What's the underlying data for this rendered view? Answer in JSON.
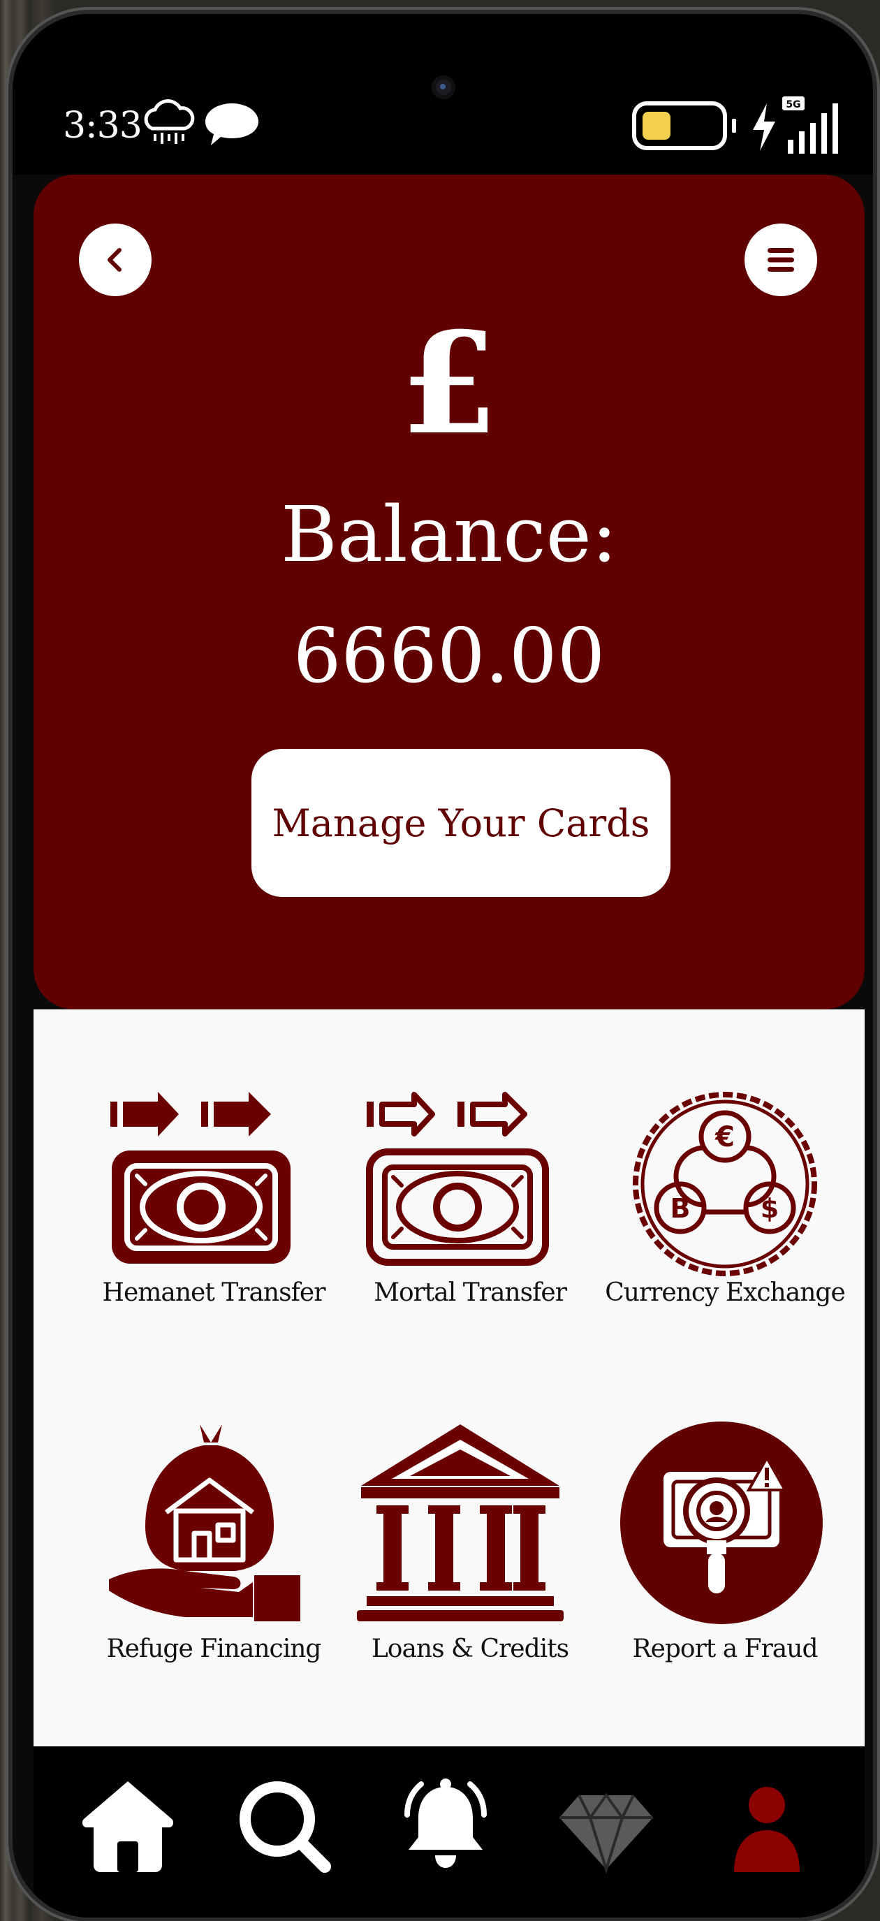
{
  "status_bar": {
    "time": "3:33",
    "icons": [
      "rain-cloud-icon",
      "chat-bubble-icon",
      "battery-icon",
      "charging-bolt-icon",
      "signal-5g-icon"
    ],
    "network": "5G"
  },
  "header": {
    "back_icon": "chevron-left-icon",
    "menu_icon": "hamburger-menu-icon",
    "currency_symbol": "£",
    "balance_label": "Balance:",
    "balance_value": "6660.00",
    "manage_cards_label": "Manage Your Cards"
  },
  "services": [
    {
      "label": "Hemanet Transfer",
      "icon": "money-transfer-solid-icon"
    },
    {
      "label": "Mortal Transfer",
      "icon": "money-transfer-outline-icon"
    },
    {
      "label": "Currency Exchange",
      "icon": "currency-exchange-icon"
    },
    {
      "label": "Refuge Financing",
      "icon": "house-financing-icon"
    },
    {
      "label": "Loans & Credits",
      "icon": "bank-icon"
    },
    {
      "label": "Report a Fraud",
      "icon": "fraud-report-icon"
    }
  ],
  "bottom_nav": [
    {
      "icon": "home-icon",
      "active": false
    },
    {
      "icon": "search-icon",
      "active": false
    },
    {
      "icon": "bell-icon",
      "active": false
    },
    {
      "icon": "diamond-icon",
      "active": false
    },
    {
      "icon": "profile-icon",
      "active": true
    }
  ],
  "colors": {
    "brand": "#600000",
    "background": "#f9f9fa",
    "nav_bg": "#000000",
    "active_nav": "#8b0000"
  }
}
